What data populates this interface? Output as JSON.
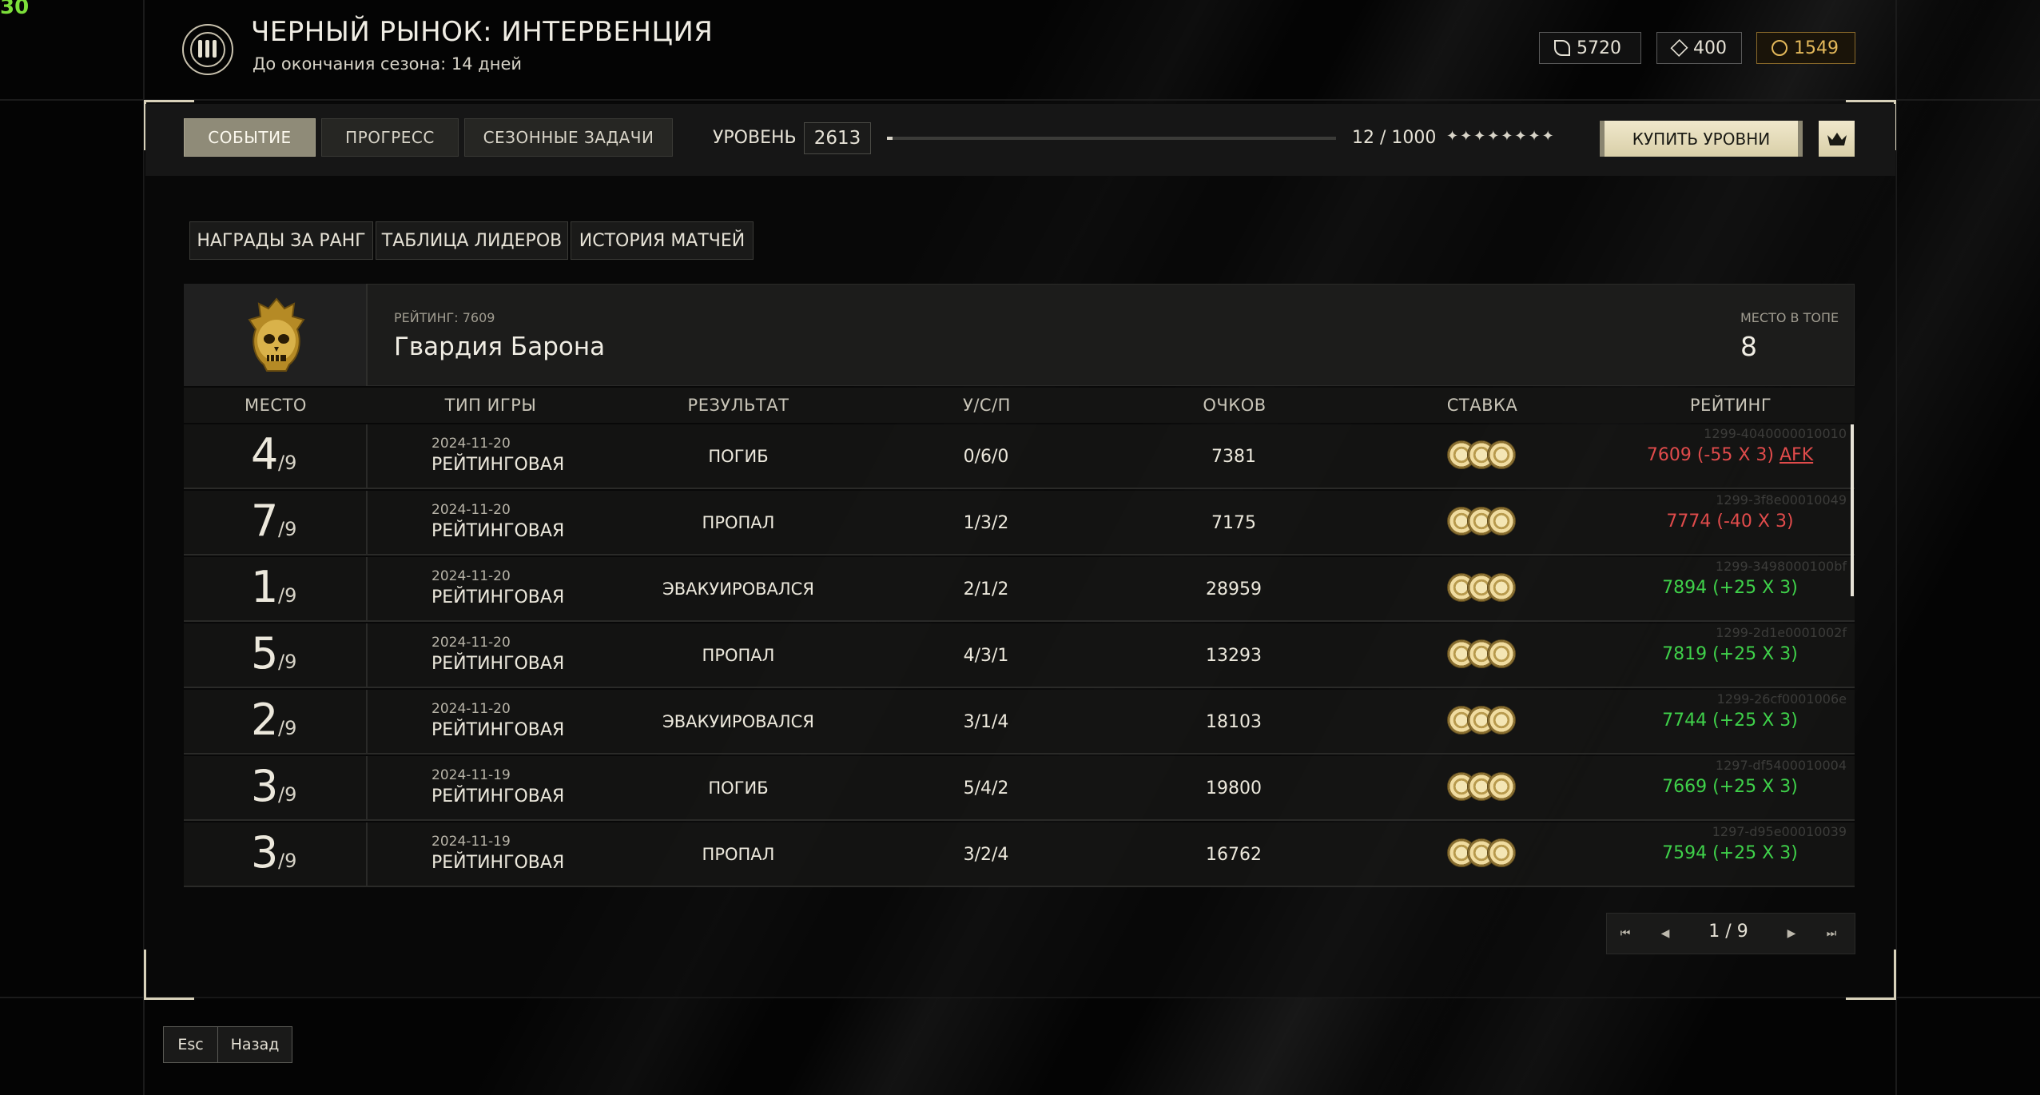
{
  "overlay": {
    "fps": "30"
  },
  "header": {
    "title": "ЧЕРНЫЙ РЫНОК: ИНТЕРВЕНЦИЯ",
    "subtitle": "До окончания сезона: 14 дней",
    "currencies": [
      {
        "icon": "feather-currency-icon",
        "value": "5720"
      },
      {
        "icon": "gem-currency-icon",
        "value": "400"
      },
      {
        "icon": "gold-coin-icon",
        "value": "1549"
      }
    ]
  },
  "tabs": [
    {
      "label": "СОБЫТИЕ",
      "active": true
    },
    {
      "label": "ПРОГРЕСС",
      "active": false
    },
    {
      "label": "СЕЗОННЫЕ ЗАДАЧИ",
      "active": false
    }
  ],
  "level": {
    "label": "УРОВЕНЬ",
    "value": "2613",
    "progress_text": "12 / 1000",
    "progress_fraction": 0.012,
    "stars": "✦✦✦✦✦✦✦✦",
    "buy_label": "КУПИТЬ УРОВНИ",
    "crown_icon": "crown-icon"
  },
  "subtabs": [
    "НАГРАДЫ ЗА РАНГ",
    "ТАБЛИЦА ЛИДЕРОВ",
    "ИСТОРИЯ МАТЧЕЙ"
  ],
  "team": {
    "rating_label": "РЕЙТИНГ: 7609",
    "name": "Гвардия Барона",
    "rank_label": "МЕСТО В ТОПЕ",
    "rank_value": "8",
    "emblem_icon": "skull-emblem-icon"
  },
  "table": {
    "columns": [
      "МЕСТО",
      "ТИП ИГРЫ",
      "РЕЗУЛЬТАТ",
      "У/С/П",
      "ОЧКОВ",
      "СТАВКА",
      "РЕЙТИНГ"
    ],
    "rows": [
      {
        "place": "4",
        "of": "/9",
        "date": "2024-11-20",
        "type": "РЕЙТИНГОВАЯ",
        "result": "ПОГИБ",
        "ksa": "0/6/0",
        "points": "7381",
        "rating": "7609 (-55 X 3)",
        "afk": "AFK",
        "sign": "neg",
        "match_id": "1299-4040000010010"
      },
      {
        "place": "7",
        "of": "/9",
        "date": "2024-11-20",
        "type": "РЕЙТИНГОВАЯ",
        "result": "ПРОПАЛ",
        "ksa": "1/3/2",
        "points": "7175",
        "rating": "7774 (-40 X 3)",
        "afk": "",
        "sign": "neg",
        "match_id": "1299-3f8e00010049"
      },
      {
        "place": "1",
        "of": "/9",
        "date": "2024-11-20",
        "type": "РЕЙТИНГОВАЯ",
        "result": "ЭВАКУИРОВАЛСЯ",
        "ksa": "2/1/2",
        "points": "28959",
        "rating": "7894 (+25 X 3)",
        "afk": "",
        "sign": "pos",
        "match_id": "1299-3498000100bf"
      },
      {
        "place": "5",
        "of": "/9",
        "date": "2024-11-20",
        "type": "РЕЙТИНГОВАЯ",
        "result": "ПРОПАЛ",
        "ksa": "4/3/1",
        "points": "13293",
        "rating": "7819 (+25 X 3)",
        "afk": "",
        "sign": "pos",
        "match_id": "1299-2d1e0001002f"
      },
      {
        "place": "2",
        "of": "/9",
        "date": "2024-11-20",
        "type": "РЕЙТИНГОВАЯ",
        "result": "ЭВАКУИРОВАЛСЯ",
        "ksa": "3/1/4",
        "points": "18103",
        "rating": "7744 (+25 X 3)",
        "afk": "",
        "sign": "pos",
        "match_id": "1299-26cf0001006e"
      },
      {
        "place": "3",
        "of": "/9",
        "date": "2024-11-19",
        "type": "РЕЙТИНГОВАЯ",
        "result": "ПОГИБ",
        "ksa": "5/4/2",
        "points": "19800",
        "rating": "7669 (+25 X 3)",
        "afk": "",
        "sign": "pos",
        "match_id": "1297-df5400010004"
      },
      {
        "place": "3",
        "of": "/9",
        "date": "2024-11-19",
        "type": "РЕЙТИНГОВАЯ",
        "result": "ПРОПАЛ",
        "ksa": "3/2/4",
        "points": "16762",
        "rating": "7594 (+25 X 3)",
        "afk": "",
        "sign": "pos",
        "match_id": "1297-d95e00010039"
      }
    ]
  },
  "pager": {
    "text": "1 / 9",
    "first_icon": "skip-first-icon",
    "prev_icon": "prev-icon",
    "next_icon": "next-icon",
    "last_icon": "skip-last-icon"
  },
  "footer": {
    "esc_label": "Esc",
    "back_label": "Назад"
  },
  "colors": {
    "accent_gold": "#e3b85a",
    "negative": "#e04b4b",
    "positive": "#3fd14a",
    "active_tab": "#8f8b78"
  }
}
